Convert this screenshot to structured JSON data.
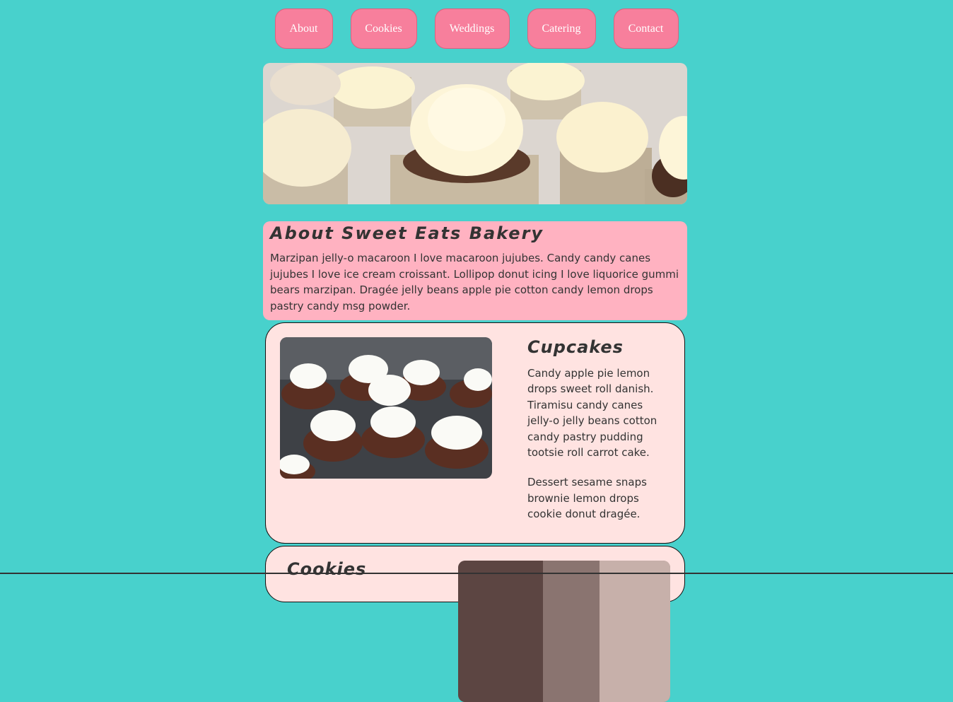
{
  "nav": {
    "items": [
      {
        "label": "About"
      },
      {
        "label": "Cookies"
      },
      {
        "label": "Weddings"
      },
      {
        "label": "Catering"
      },
      {
        "label": "Contact"
      }
    ]
  },
  "about": {
    "title": "About Sweet Eats Bakery",
    "text": "Marzipan jelly-o macaroon I love macaroon jujubes. Candy candy canes jujubes I love ice cream croissant. Lollipop donut icing I love liquorice gummi bears marzipan. Dragée jelly beans apple pie cotton candy lemon drops pastry candy msg powder."
  },
  "cards": [
    {
      "title": "Cupcakes",
      "paragraphs": [
        "Candy apple pie lemon drops sweet roll danish. Tiramisu candy canes jelly-o jelly beans cotton candy pastry pudding tootsie roll carrot cake.",
        "Dessert sesame snaps brownie lemon drops cookie donut dragée."
      ]
    },
    {
      "title": "Cookies"
    }
  ],
  "colors": {
    "background": "#48d1cc",
    "nav_button": "#f77f9c",
    "about_box": "#ffb2c1",
    "card": "#ffe3e1"
  }
}
